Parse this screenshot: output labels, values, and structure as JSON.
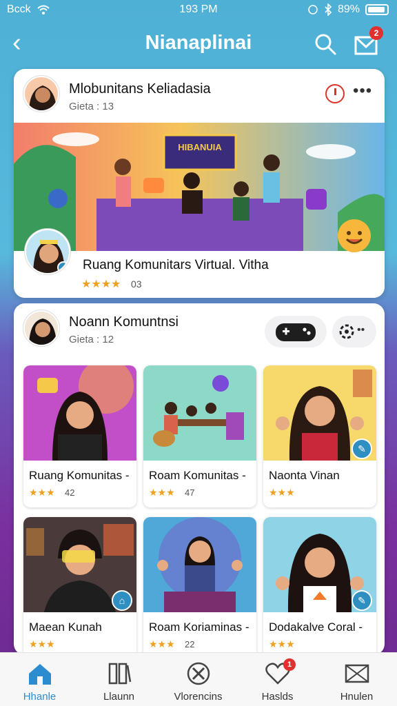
{
  "status_bar": {
    "carrier": "Bcck",
    "time": "193 PM",
    "battery": "89%"
  },
  "header": {
    "title": "Nianaplinai",
    "mail_badge": "2"
  },
  "post1": {
    "author": "Mlobunitans Keliadasia",
    "meta": "Gieta : 13",
    "banner_sign": "HIBANUIA",
    "room_title": "Ruang Komunitars Virtual. Vitha",
    "room_stars": "★★★★",
    "room_count": "03"
  },
  "post2": {
    "author": "Noann Komuntnsi",
    "meta": "Gieta : 12"
  },
  "tiles": [
    {
      "label": "Ruang Komunitas -",
      "stars": "★★★",
      "count": "42",
      "colors": [
        "#c24fc8",
        "#f3a24a"
      ]
    },
    {
      "label": "Roam Komunitas -",
      "stars": "★★★",
      "count": "47",
      "colors": [
        "#8ed8c8",
        "#5fc2c0"
      ]
    },
    {
      "label": "Naonta Vinan",
      "stars": "★★★",
      "count": "",
      "colors": [
        "#f7d86a",
        "#f1c24c"
      ]
    },
    {
      "label": "Maean Kunah",
      "stars": "★★★",
      "count": "",
      "colors": [
        "#4a3a3a",
        "#6a5040"
      ]
    },
    {
      "label": "Roam Koriaminas -",
      "stars": "★★★",
      "count": "22",
      "colors": [
        "#4fa8d8",
        "#7a5cc8"
      ]
    },
    {
      "label": "Dodakalve Coral -",
      "stars": "★★★",
      "count": "",
      "colors": [
        "#8fd4e6",
        "#5cbfe0"
      ]
    }
  ],
  "bottom_nav": [
    {
      "label": "Hhanle",
      "icon": "home-icon",
      "active": true
    },
    {
      "label": "Llaunn",
      "icon": "library-icon",
      "active": false
    },
    {
      "label": "Vlorencins",
      "icon": "tools-icon",
      "active": false
    },
    {
      "label": "Haslds",
      "icon": "heart-icon",
      "active": false,
      "badge": "1"
    },
    {
      "label": "Hnulen",
      "icon": "envelope-icon",
      "active": false
    }
  ],
  "colors": {
    "accent": "#2b8cd0",
    "badge": "#e0302f",
    "star": "#f0a020"
  }
}
